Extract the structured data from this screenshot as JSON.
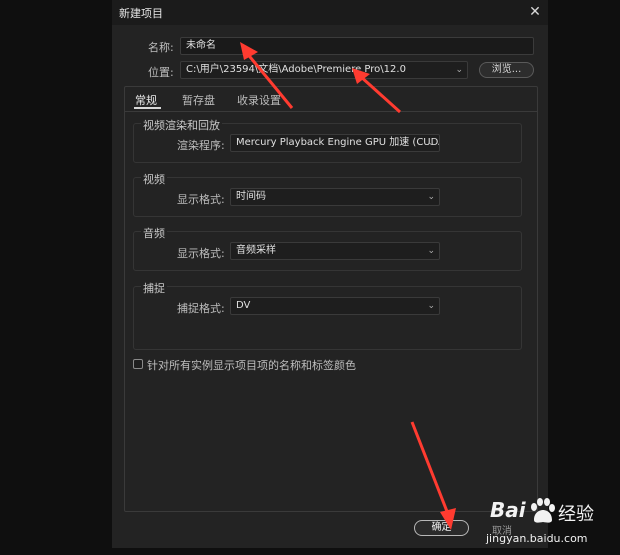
{
  "dialog": {
    "title": "新建项目",
    "close_glyph": "✕"
  },
  "name_row": {
    "label": "名称:",
    "value": "未命名"
  },
  "location_row": {
    "label": "位置:",
    "value": "C:\\用户\\23594\\文档\\Adobe\\Premiere Pro\\12.0",
    "browse_label": "浏览..."
  },
  "tabs": [
    {
      "label": "常规",
      "active": true
    },
    {
      "label": "暂存盘",
      "active": false
    },
    {
      "label": "收录设置",
      "active": false
    }
  ],
  "groups": {
    "render": {
      "title": "视频渲染和回放",
      "label": "渲染程序:",
      "value": "Mercury Playback Engine GPU 加速 (CUDA)"
    },
    "video": {
      "title": "视频",
      "label": "显示格式:",
      "value": "时间码"
    },
    "audio": {
      "title": "音频",
      "label": "显示格式:",
      "value": "音频采样"
    },
    "capture": {
      "title": "捕捉",
      "label": "捕捉格式:",
      "value": "DV"
    }
  },
  "checkbox": {
    "label": "针对所有实例显示项目项的名称和标签颜色",
    "checked": false
  },
  "footer": {
    "ok_label": "确定",
    "cancel_label": "取消"
  },
  "watermark": {
    "brand": "Bai",
    "brand2": "经验",
    "url": "jingyan.baidu.com"
  },
  "colors": {
    "annotation_arrow": "#ff3b30",
    "background": "#232323"
  },
  "icons": [
    "close-icon",
    "chevron-down-icon",
    "paw-icon"
  ]
}
